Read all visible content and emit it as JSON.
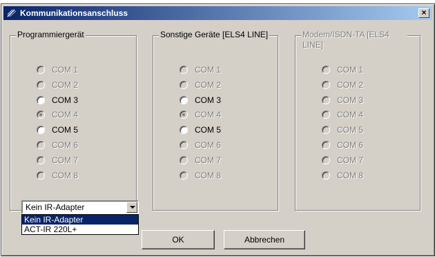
{
  "window": {
    "title": "Kommunikationsanschluss",
    "close_label": "×"
  },
  "groups": [
    {
      "title": "Programmiergerät",
      "title_enabled": true,
      "radios": [
        {
          "label": "COM 1",
          "enabled": false,
          "checked": false
        },
        {
          "label": "COM 2",
          "enabled": false,
          "checked": false
        },
        {
          "label": "COM 3",
          "enabled": true,
          "checked": false
        },
        {
          "label": "COM 4",
          "enabled": false,
          "checked": true
        },
        {
          "label": "COM 5",
          "enabled": true,
          "checked": false
        },
        {
          "label": "COM 6",
          "enabled": false,
          "checked": false
        },
        {
          "label": "COM 7",
          "enabled": false,
          "checked": false
        },
        {
          "label": "COM 8",
          "enabled": false,
          "checked": false
        }
      ]
    },
    {
      "title": "Sonstige Geräte [ELS4 LINE]",
      "title_enabled": true,
      "radios": [
        {
          "label": "COM 1",
          "enabled": false,
          "checked": false
        },
        {
          "label": "COM 2",
          "enabled": false,
          "checked": false
        },
        {
          "label": "COM 3",
          "enabled": true,
          "checked": false
        },
        {
          "label": "COM 4",
          "enabled": false,
          "checked": true
        },
        {
          "label": "COM 5",
          "enabled": true,
          "checked": false
        },
        {
          "label": "COM 6",
          "enabled": false,
          "checked": false
        },
        {
          "label": "COM 7",
          "enabled": false,
          "checked": false
        },
        {
          "label": "COM 8",
          "enabled": false,
          "checked": false
        }
      ]
    },
    {
      "title": "Modem/ISDN-TA [ELS4 LINE]",
      "title_enabled": false,
      "radios": [
        {
          "label": "COM 1",
          "enabled": false,
          "checked": false
        },
        {
          "label": "COM 2",
          "enabled": false,
          "checked": false
        },
        {
          "label": "COM 3",
          "enabled": false,
          "checked": false
        },
        {
          "label": "COM 4",
          "enabled": false,
          "checked": false
        },
        {
          "label": "COM 5",
          "enabled": false,
          "checked": false
        },
        {
          "label": "COM 6",
          "enabled": false,
          "checked": false
        },
        {
          "label": "COM 7",
          "enabled": false,
          "checked": false
        },
        {
          "label": "COM 8",
          "enabled": false,
          "checked": false
        }
      ]
    }
  ],
  "adapter_combo": {
    "selected": "Kein IR-Adapter",
    "options": [
      "Kein IR-Adapter",
      "ACT-IR 220L+"
    ],
    "highlighted_option": "Kein IR-Adapter"
  },
  "buttons": {
    "ok": "OK",
    "cancel": "Abbrechen"
  },
  "colors": {
    "titlebar_start": "#0a246a",
    "titlebar_end": "#a6caf0",
    "face": "#d4d0c8",
    "selection": "#0a246a"
  }
}
